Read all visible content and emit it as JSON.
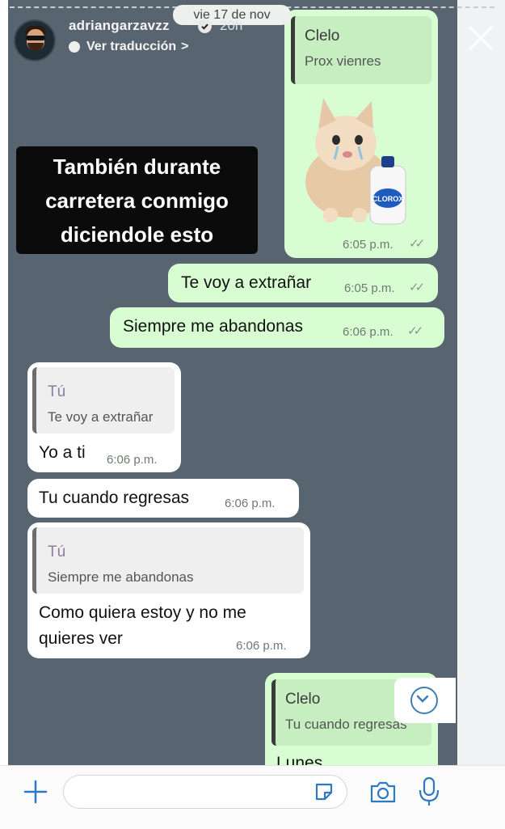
{
  "story": {
    "username": "adriangarzavzz",
    "time_ago": "20h",
    "translate_label": "Ver traducción",
    "translate_chevron": ">",
    "caption_lines": [
      "También durante",
      "carretera conmigo",
      "diciendole esto"
    ]
  },
  "chat": {
    "date_chip": "vie 17 de nov",
    "messages": [
      {
        "from": "out",
        "quote_author": "Clelo",
        "quote_text": "Prox vienres",
        "sticker": "crying-cat-with-clorox",
        "time": "6:05 p.m."
      },
      {
        "from": "out",
        "text": "Te voy a extrañar",
        "time": "6:05 p.m."
      },
      {
        "from": "out",
        "text": "Siempre me abandonas",
        "time": "6:06 p.m."
      },
      {
        "from": "in",
        "quote_author": "Tú",
        "quote_text": "Te voy a extrañar",
        "text": "Yo a ti",
        "time": "6:06 p.m."
      },
      {
        "from": "in",
        "text": "Tu cuando regresas",
        "time": "6:06 p.m."
      },
      {
        "from": "in",
        "quote_author": "Tú",
        "quote_text": "Siempre me abandonas",
        "text_lines": [
          "Como quiera estoy y no me",
          "quieres ver"
        ],
        "time": "6:06 p.m."
      },
      {
        "from": "out",
        "quote_author": "Clelo",
        "quote_text": "Tu cuando regresas",
        "text": "Lunes"
      }
    ],
    "sticker_label": "CLOROX"
  },
  "icons": {
    "close": "close-icon",
    "verified": "verified-badge-icon",
    "plus": "plus-icon",
    "sticker": "sticker-icon",
    "camera": "camera-icon",
    "mic": "microphone-icon",
    "scroll_down": "chevron-down-circle-icon"
  },
  "colors": {
    "chat_bg": "#586570",
    "outgoing_bubble": "#d9fdd3",
    "incoming_bubble": "#ffffff",
    "quote_author_out": "#3b3b3b",
    "quote_author_in": "#8b7e9a",
    "accent_blue": "#2f79c2"
  }
}
